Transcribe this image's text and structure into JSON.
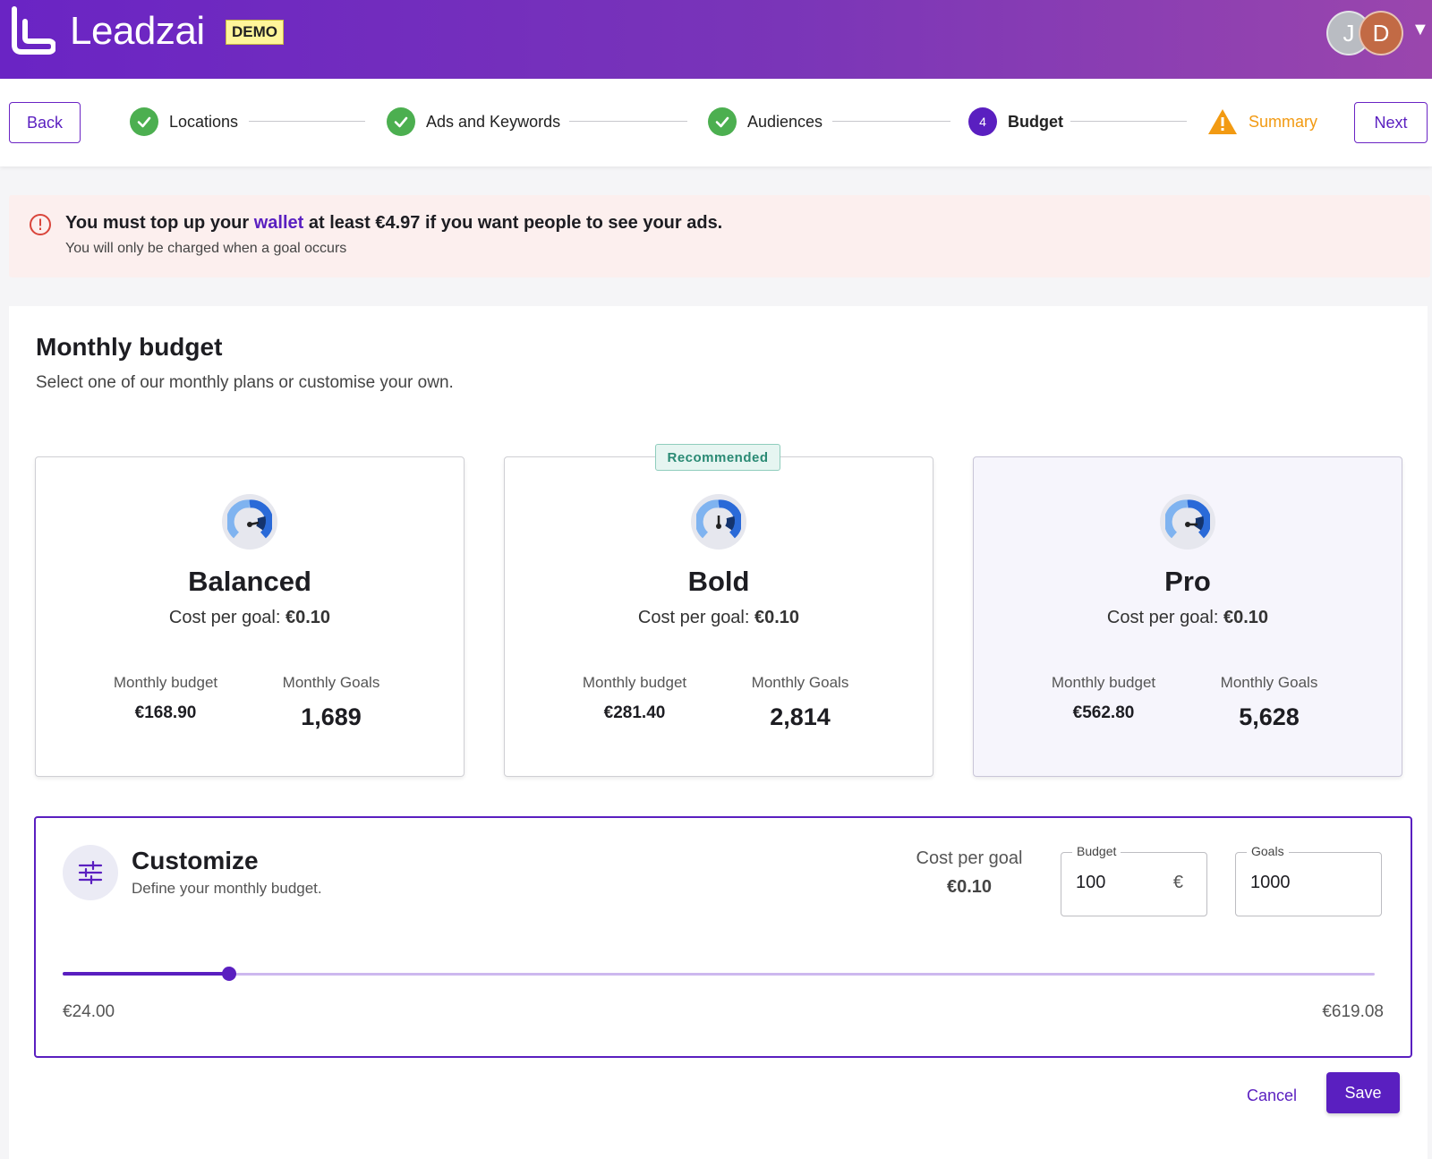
{
  "header": {
    "brand": "Leadzai",
    "badge": "DEMO",
    "avatars": [
      "J",
      "D"
    ]
  },
  "nav": {
    "back_label": "Back",
    "next_label": "Next"
  },
  "steps": [
    {
      "label": "Locations",
      "status": "done"
    },
    {
      "label": "Ads and Keywords",
      "status": "done"
    },
    {
      "label": "Audiences",
      "status": "done"
    },
    {
      "label": "Budget",
      "status": "active",
      "number": "4"
    },
    {
      "label": "Summary",
      "status": "warning"
    }
  ],
  "alert": {
    "title_pre": "You must top up your ",
    "title_link": "wallet",
    "title_post": " at least €4.97 if you want people to see your ads.",
    "subtitle": "You will only be charged when a goal occurs"
  },
  "budget": {
    "title": "Monthly budget",
    "subtitle": "Select one of our monthly plans or customise your own.",
    "recommended_label": "Recommended",
    "plans": [
      {
        "name": "Balanced",
        "cost_label": "Cost per goal: ",
        "cost_value": "€0.10",
        "mb_label": "Monthly budget",
        "mb_value": "€168.90",
        "mg_label": "Monthly Goals",
        "mg_value": "1,689"
      },
      {
        "name": "Bold",
        "cost_label": "Cost per goal: ",
        "cost_value": "€0.10",
        "mb_label": "Monthly budget",
        "mb_value": "€281.40",
        "mg_label": "Monthly Goals",
        "mg_value": "2,814"
      },
      {
        "name": "Pro",
        "cost_label": "Cost per goal: ",
        "cost_value": "€0.10",
        "mb_label": "Monthly budget",
        "mb_value": "€562.80",
        "mg_label": "Monthly Goals",
        "mg_value": "5,628"
      }
    ]
  },
  "customize": {
    "title": "Customize",
    "subtitle": "Define your monthly budget.",
    "cpg_label": "Cost per goal",
    "cpg_value": "€0.10",
    "budget_label": "Budget",
    "budget_value": "100",
    "budget_suffix": "€",
    "goals_label": "Goals",
    "goals_value": "1000",
    "slider_min": "€24.00",
    "slider_max": "€619.08",
    "slider_fraction": 0.127
  },
  "actions": {
    "cancel_label": "Cancel",
    "save_label": "Save"
  },
  "colors": {
    "accent": "#5a1fc0",
    "success": "#4caf50",
    "warning": "#f29a12",
    "alert_bg": "#fcefee"
  }
}
